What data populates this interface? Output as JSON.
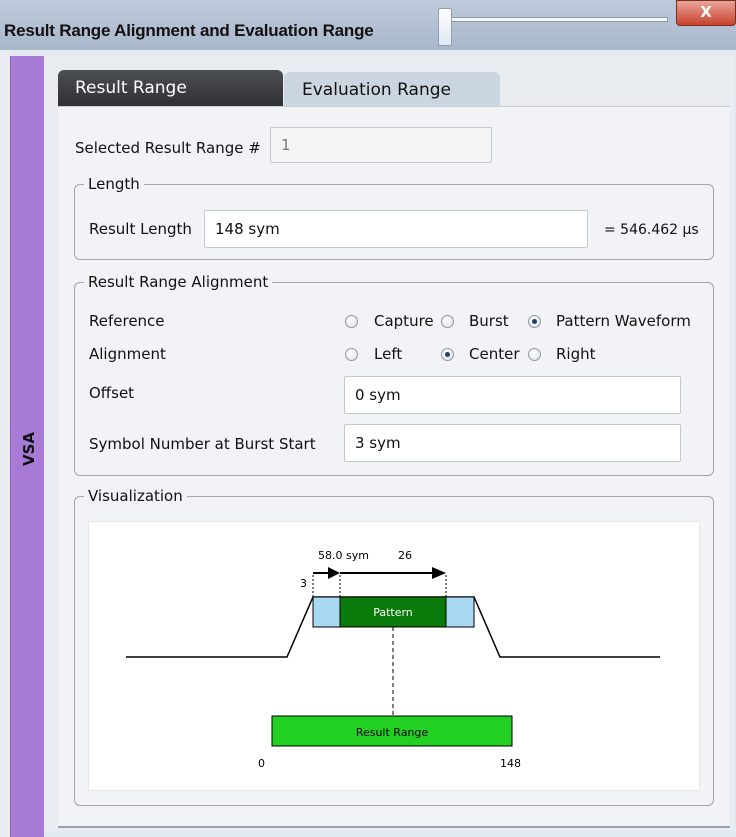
{
  "window": {
    "title": "Result Range Alignment and Evaluation Range",
    "close_label": "X"
  },
  "side_panel": {
    "label": "VSA"
  },
  "tabs": [
    {
      "label": "Result Range",
      "active": true
    },
    {
      "label": "Evaluation Range",
      "active": false
    }
  ],
  "selected_result_range": {
    "label": "Selected Result Range #",
    "value": "1"
  },
  "length": {
    "legend": "Length",
    "result_length_label": "Result Length",
    "result_length_value": "148 sym",
    "result_length_time": "= 546.462 µs"
  },
  "alignment": {
    "legend": "Result Range Alignment",
    "reference_label": "Reference",
    "reference_options": [
      "Capture",
      "Burst",
      "Pattern Waveform"
    ],
    "reference_selected": "Pattern Waveform",
    "alignment_label": "Alignment",
    "alignment_options": [
      "Left",
      "Center",
      "Right"
    ],
    "alignment_selected": "Center",
    "offset_label": "Offset",
    "offset_value": "0 sym",
    "symbol_number_label": "Symbol Number at Burst Start",
    "symbol_number_value": "3 sym"
  },
  "visualization": {
    "legend": "Visualization",
    "pattern_length": "58.0 sym",
    "pattern_end_label": "26",
    "pattern_start_label": "3",
    "pattern_label": "Pattern",
    "result_range_label": "Result Range",
    "result_start": "0",
    "result_end": "148",
    "colors": {
      "pattern": "#0a7a0a",
      "guard": "#a9d8f2",
      "result_range": "#22d022"
    }
  }
}
